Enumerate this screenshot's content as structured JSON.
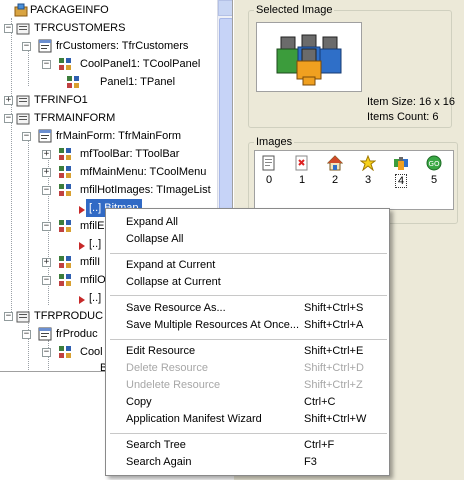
{
  "tree": {
    "nodes": [
      {
        "label": "PACKAGEINFO",
        "expander": ""
      },
      {
        "label": "TFRCUSTOMERS",
        "expander": "−"
      },
      {
        "label": "frCustomers: TfrCustomers",
        "expander": "−"
      },
      {
        "label": "CoolPanel1: TCoolPanel",
        "expander": "−"
      },
      {
        "label": "Panel1: TPanel",
        "expander": ""
      },
      {
        "label": "TFRINFO1",
        "expander": "+"
      },
      {
        "label": "TFRMAINFORM",
        "expander": "−"
      },
      {
        "label": "frMainForm: TfrMainForm",
        "expander": "−"
      },
      {
        "label": "mfToolBar: TToolBar",
        "expander": "+"
      },
      {
        "label": "mfMainMenu: TCoolMenu",
        "expander": "+"
      },
      {
        "label": "mfilHotImages: TImageList",
        "expander": "−"
      },
      {
        "label": "[..] Bitmap",
        "expander": ""
      },
      {
        "label": "mfilE",
        "expander": "−"
      },
      {
        "label": "[..] B",
        "expander": ""
      },
      {
        "label": "mfilI",
        "expander": "+"
      },
      {
        "label": "mfilO",
        "expander": "−"
      },
      {
        "label": "[..] B",
        "expander": ""
      },
      {
        "label": "TFRPRODUC",
        "expander": "−"
      },
      {
        "label": "frProduc",
        "expander": "−"
      },
      {
        "label": "Cool",
        "expander": "−"
      },
      {
        "label": "B",
        "expander": ""
      }
    ]
  },
  "right_panel": {
    "selected_image_title": "Selected Image",
    "item_size": "Item Size: 16 x 16",
    "items_count": "Items Count: 6",
    "images_title": "Images",
    "image_numbers": [
      "0",
      "1",
      "2",
      "3",
      "4",
      "5"
    ],
    "image_icons": [
      "document-icon",
      "delete-document-icon",
      "home-icon",
      "star-icon",
      "users-icon",
      "go-icon"
    ]
  },
  "context_menu": {
    "groups": [
      [
        {
          "label": "Expand All",
          "shortcut": "",
          "enabled": true
        },
        {
          "label": "Collapse All",
          "shortcut": "",
          "enabled": true
        }
      ],
      [
        {
          "label": "Expand at Current",
          "shortcut": "",
          "enabled": true
        },
        {
          "label": "Collapse at Current",
          "shortcut": "",
          "enabled": true
        }
      ],
      [
        {
          "label": "Save Resource As...",
          "shortcut": "Shift+Ctrl+S",
          "enabled": true
        },
        {
          "label": "Save Multiple Resources At Once...",
          "shortcut": "Shift+Ctrl+A",
          "enabled": true
        }
      ],
      [
        {
          "label": "Edit Resource",
          "shortcut": "Shift+Ctrl+E",
          "enabled": true
        },
        {
          "label": "Delete Resource",
          "shortcut": "Shift+Ctrl+D",
          "enabled": false
        },
        {
          "label": "Undelete Resource",
          "shortcut": "Shift+Ctrl+Z",
          "enabled": false
        },
        {
          "label": "Copy",
          "shortcut": "Ctrl+C",
          "enabled": true
        },
        {
          "label": "Application Manifest Wizard",
          "shortcut": "Shift+Ctrl+W",
          "enabled": true
        }
      ],
      [
        {
          "label": "Search Tree",
          "shortcut": "Ctrl+F",
          "enabled": true
        },
        {
          "label": "Search Again",
          "shortcut": "F3",
          "enabled": true
        }
      ]
    ]
  },
  "colors": {
    "selection": "#316ac5",
    "panel_bg": "#ece9d8",
    "disabled_text": "#a7a7a7"
  }
}
